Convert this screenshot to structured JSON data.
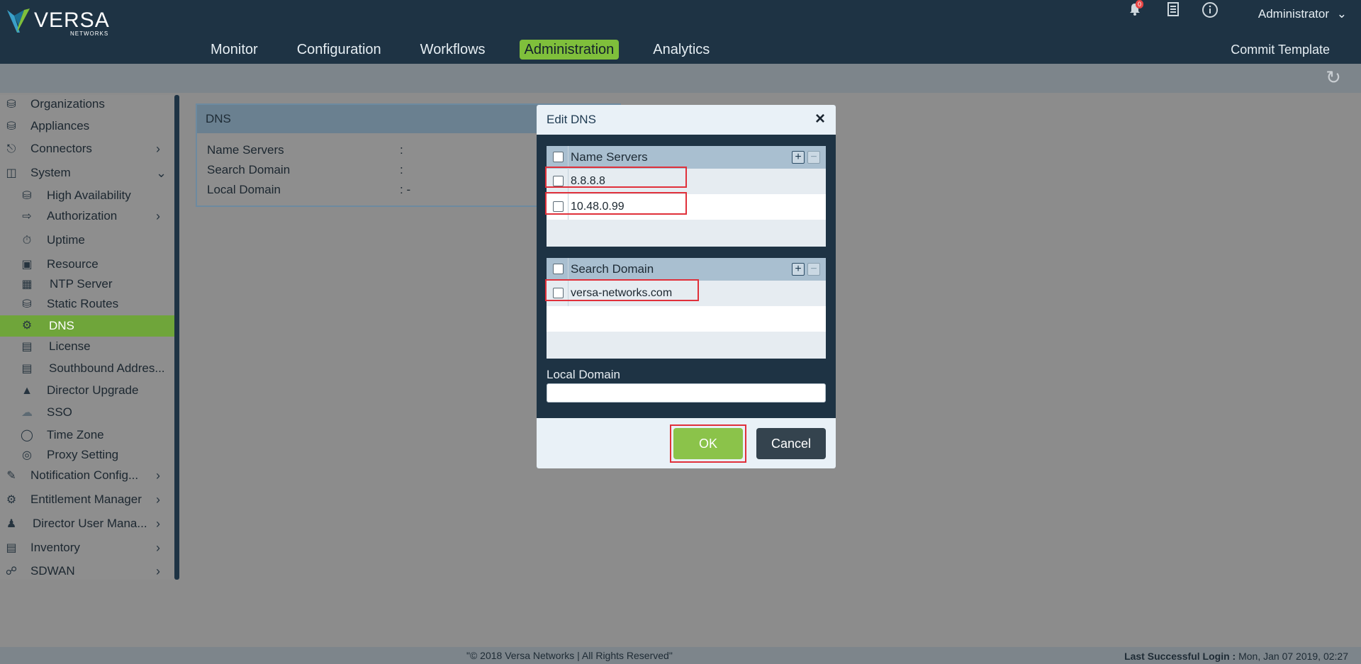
{
  "brand": {
    "name": "VERSA",
    "sub": "NETWORKS"
  },
  "nav": [
    "Monitor",
    "Configuration",
    "Workflows",
    "Administration",
    "Analytics"
  ],
  "header": {
    "commit": "Commit Template",
    "user": "Administrator",
    "notif_count": "0"
  },
  "sidebar": {
    "items": [
      {
        "label": "Organizations"
      },
      {
        "label": "Appliances"
      },
      {
        "label": "Connectors"
      },
      {
        "label": "System"
      },
      {
        "label": "High Availability"
      },
      {
        "label": "Authorization"
      },
      {
        "label": "Uptime"
      },
      {
        "label": "Resource"
      },
      {
        "label": "NTP Server"
      },
      {
        "label": "Static Routes"
      },
      {
        "label": "DNS"
      },
      {
        "label": "License"
      },
      {
        "label": "Southbound Addres..."
      },
      {
        "label": "Director Upgrade"
      },
      {
        "label": "SSO"
      },
      {
        "label": "Time Zone"
      },
      {
        "label": "Proxy Setting"
      },
      {
        "label": "Notification Config..."
      },
      {
        "label": "Entitlement Manager"
      },
      {
        "label": "Director User Mana..."
      },
      {
        "label": "Inventory"
      },
      {
        "label": "SDWAN"
      }
    ]
  },
  "dns_panel": {
    "title": "DNS",
    "rows": [
      {
        "label": "Name Servers",
        "value": ":"
      },
      {
        "label": "Search Domain",
        "value": ":"
      },
      {
        "label": "Local Domain",
        "value": ": -"
      }
    ]
  },
  "modal": {
    "title": "Edit DNS",
    "name_servers": {
      "header": "Name Servers",
      "values": [
        "8.8.8.8",
        "10.48.0.99"
      ]
    },
    "search_domain": {
      "header": "Search Domain",
      "values": [
        "versa-networks.com"
      ]
    },
    "local_domain_label": "Local Domain",
    "local_domain_value": "",
    "ok": "OK",
    "cancel": "Cancel"
  },
  "footer": {
    "copyright": "\"© 2018 Versa Networks | All Rights Reserved\"",
    "last_login_label": "Last Successful Login :",
    "last_login_value": "Mon, Jan 07 2019, 02:27"
  },
  "colors": {
    "header_bg": "#1e3344",
    "accent": "#7fbf3b",
    "highlight": "#e0303a"
  }
}
